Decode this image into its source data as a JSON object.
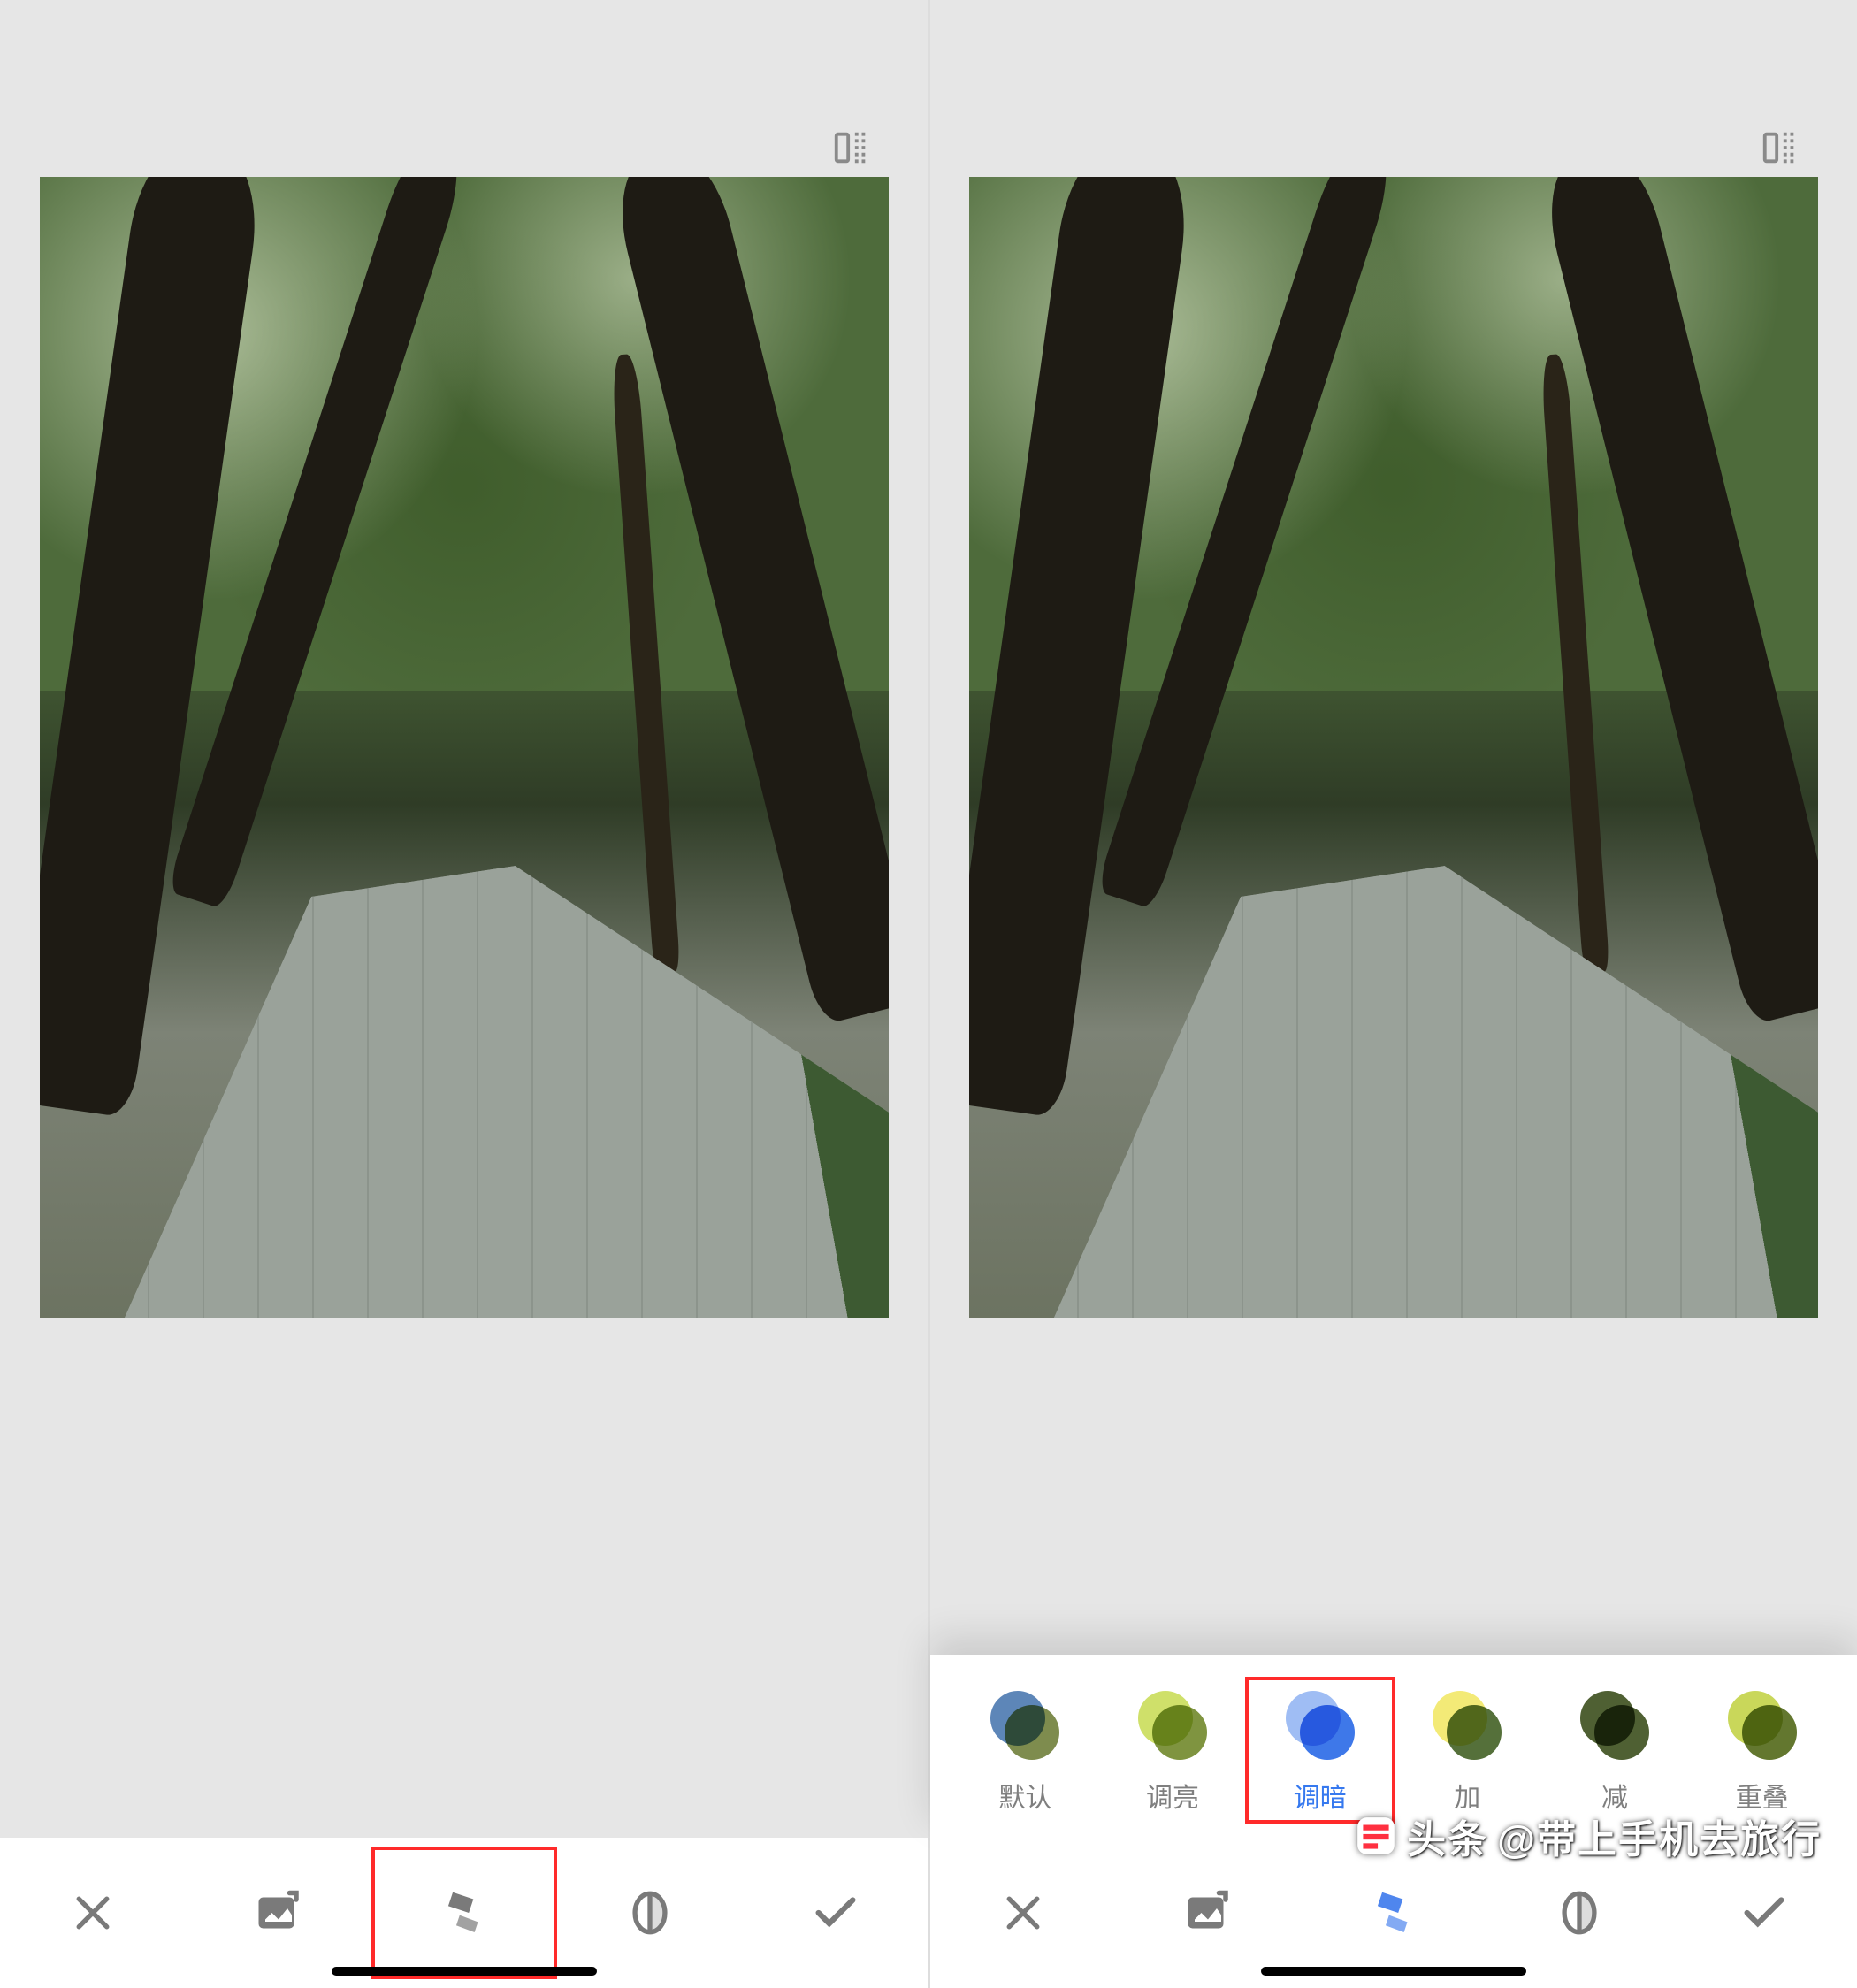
{
  "left": {
    "toolbar": {
      "close": "close",
      "addImage": "add-image",
      "styles": "styles",
      "mask": "mask",
      "confirm": "confirm",
      "selected": "styles"
    }
  },
  "right": {
    "styles": [
      {
        "key": "default",
        "label": "默认",
        "c1": "#5d86b8",
        "c2": "#7e8c4e"
      },
      {
        "key": "lighten",
        "label": "调亮",
        "c1": "#cfe06a",
        "c2": "#7f9440"
      },
      {
        "key": "darken",
        "label": "调暗",
        "c1": "#9fbdf4",
        "c2": "#3e78e9",
        "selected": true
      },
      {
        "key": "add",
        "label": "加",
        "c1": "#f3ea77",
        "c2": "#55703a"
      },
      {
        "key": "subtract",
        "label": "减",
        "c1": "#4f6033",
        "c2": "#4f6033"
      },
      {
        "key": "overlay",
        "label": "重叠",
        "c1": "#c9d75a",
        "c2": "#63772f"
      }
    ],
    "toolbar": {
      "close": "close",
      "addImage": "add-image",
      "styles": "styles",
      "mask": "mask",
      "confirm": "confirm",
      "selected": "styles"
    }
  },
  "watermark": {
    "prefix": "头条",
    "handle": "@带上手机去旅行"
  }
}
